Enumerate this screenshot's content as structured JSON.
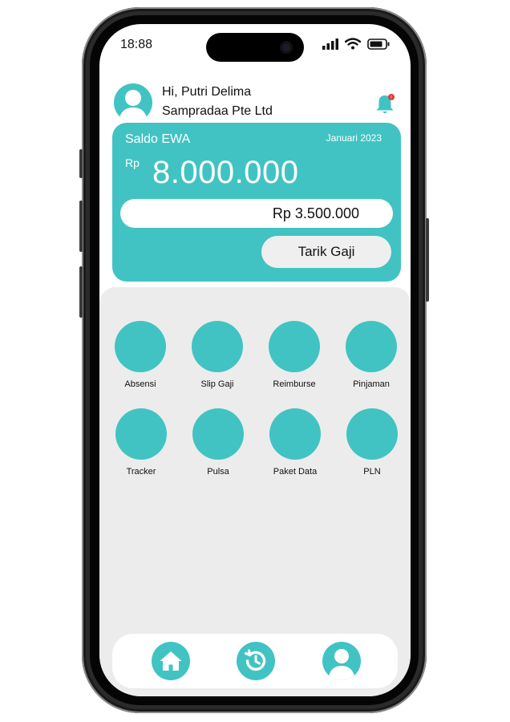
{
  "status_bar": {
    "time": "18:88"
  },
  "header": {
    "greeting": "Hi, Putri Delima",
    "company": "Sampradaa Pte Ltd",
    "notification_badge": "!"
  },
  "balance_card": {
    "title": "Saldo EWA",
    "period": "Januari 2023",
    "currency": "Rp",
    "amount": "8.000.000",
    "available": "Rp 3.500.000",
    "withdraw_label": "Tarik Gaji"
  },
  "menu": {
    "items": [
      {
        "label": "Absensi"
      },
      {
        "label": "Slip Gaji"
      },
      {
        "label": "Reimburse"
      },
      {
        "label": "Pinjaman"
      },
      {
        "label": "Tracker"
      },
      {
        "label": "Pulsa"
      },
      {
        "label": "Paket Data"
      },
      {
        "label": "PLN"
      }
    ]
  },
  "bottom_nav": {
    "items": [
      {
        "icon": "home-icon"
      },
      {
        "icon": "history-icon"
      },
      {
        "icon": "profile-icon"
      }
    ]
  },
  "colors": {
    "accent": "#41c3c3",
    "background": "#ececec",
    "notification": "#e53935"
  }
}
